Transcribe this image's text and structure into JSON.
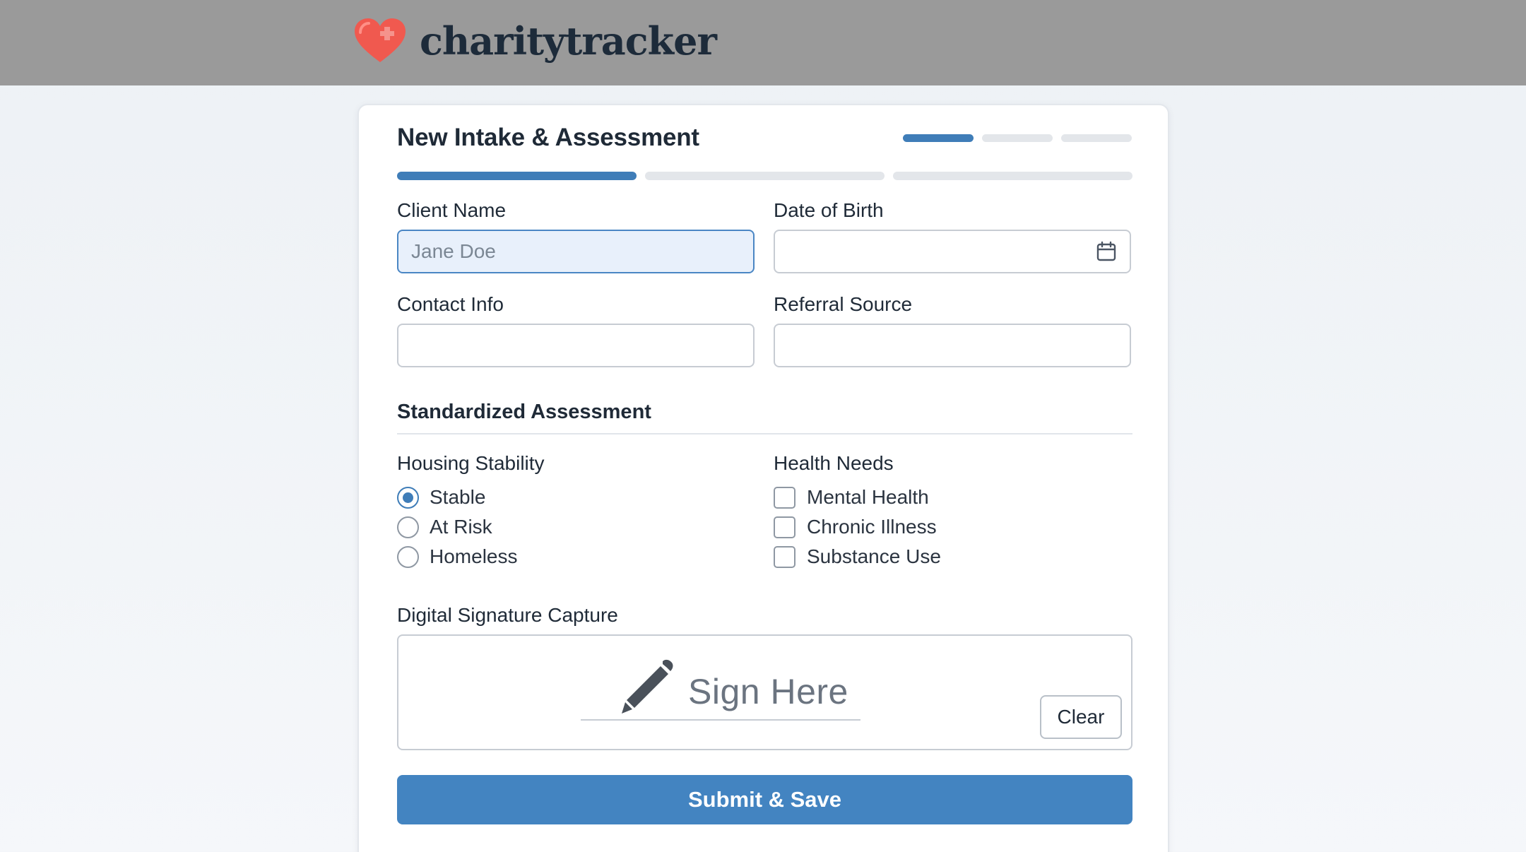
{
  "header": {
    "brand_name": "charitytracker",
    "logo_icon": "heart-cross-icon",
    "logo_color": "#f0594f"
  },
  "form": {
    "title": "New Intake & Assessment",
    "progress": {
      "current_step": 1,
      "total_steps": 3
    },
    "fields": {
      "client_name": {
        "label": "Client Name",
        "value": "",
        "placeholder": "Jane Doe"
      },
      "date_of_birth": {
        "label": "Date of Birth",
        "value": "",
        "icon": "calendar-icon"
      },
      "contact_info": {
        "label": "Contact Info",
        "value": ""
      },
      "referral_source": {
        "label": "Referral Source",
        "value": ""
      }
    },
    "assessment": {
      "title": "Standardized Assessment",
      "housing": {
        "label": "Housing Stability",
        "options": [
          "Stable",
          "At Risk",
          "Homeless"
        ],
        "selected": "Stable"
      },
      "health": {
        "label": "Health Needs",
        "options": [
          "Mental Health",
          "Chronic Illness",
          "Substance Use"
        ],
        "checked": []
      }
    },
    "signature": {
      "label": "Digital Signature Capture",
      "placeholder": "Sign Here",
      "icon": "pencil-icon",
      "clear_label": "Clear"
    },
    "submit_label": "Submit & Save"
  },
  "colors": {
    "accent": "#3f7db8",
    "submit": "#4384c1",
    "topbar": "#9a9a9a",
    "focus_bg": "#e8f0fb"
  }
}
